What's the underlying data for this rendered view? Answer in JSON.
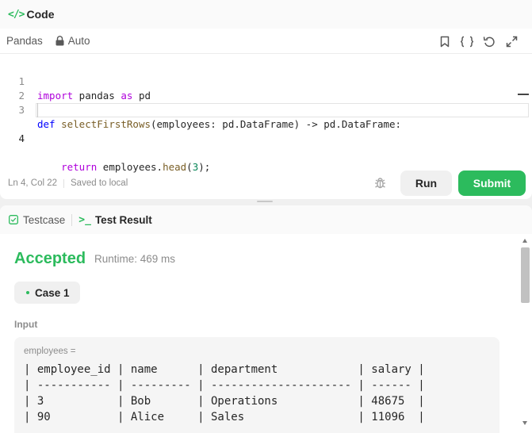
{
  "code_panel": {
    "title": "Code",
    "language": "Pandas",
    "mode": "Auto",
    "toolbar_icons": [
      "bookmark-icon",
      "braces-icon",
      "reset-icon",
      "expand-icon"
    ],
    "lines": [
      {
        "num": "1"
      },
      {
        "num": "2"
      },
      {
        "num": "3"
      },
      {
        "num": "4"
      }
    ],
    "status": {
      "position": "Ln 4, Col 22",
      "saved": "Saved to local"
    },
    "run_label": "Run",
    "submit_label": "Submit",
    "colors": {
      "accent": "#2cbb5d",
      "keyword": "#af00db"
    }
  },
  "result_panel": {
    "tabs": {
      "testcase": "Testcase",
      "test_result": "Test Result"
    },
    "verdict": "Accepted",
    "runtime": "Runtime: 469 ms",
    "case_label": "Case 1",
    "input_label": "Input",
    "var_name": "employees =",
    "table_lines": [
      "| employee_id | name      | department            | salary |",
      "| ----------- | --------- | --------------------- | ------ |",
      "| 3           | Bob       | Operations            | 48675  |",
      "| 90          | Alice     | Sales                 | 11096  |"
    ]
  }
}
